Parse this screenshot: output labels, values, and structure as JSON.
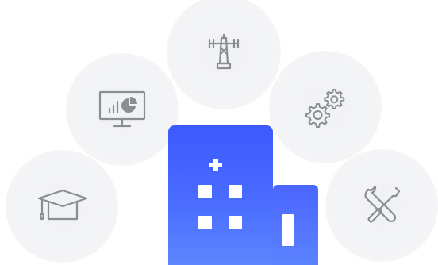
{
  "colors": {
    "building": "#3d5afe",
    "building_light": "#5d86ff",
    "bubble": "#f3f4f6",
    "icon_stroke": "#8a8d94"
  },
  "icons": {
    "top": "antenna-tower-icon",
    "top_left": "monitor-chart-icon",
    "top_right": "gears-icon",
    "bottom_left": "graduation-cap-icon",
    "bottom_right": "wrench-screwdriver-icon",
    "center": "hospital-building-icon"
  }
}
